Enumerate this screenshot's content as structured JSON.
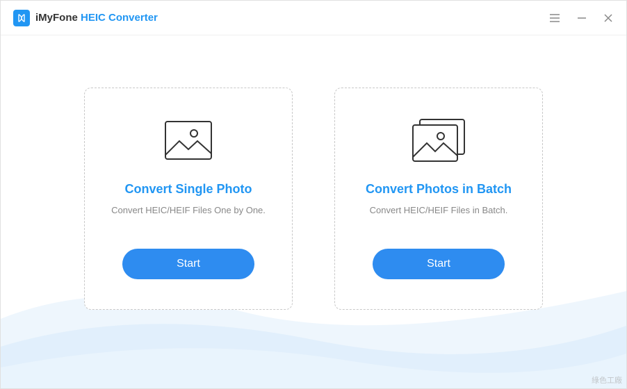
{
  "header": {
    "brand": "iMyFone",
    "product": "HEIC Converter"
  },
  "cards": {
    "single": {
      "title": "Convert Single Photo",
      "subtitle": "Convert HEIC/HEIF Files One by One.",
      "button": "Start"
    },
    "batch": {
      "title": "Convert Photos in Batch",
      "subtitle": "Convert HEIC/HEIF Files in Batch.",
      "button": "Start"
    }
  },
  "watermark": "綠色工廠"
}
